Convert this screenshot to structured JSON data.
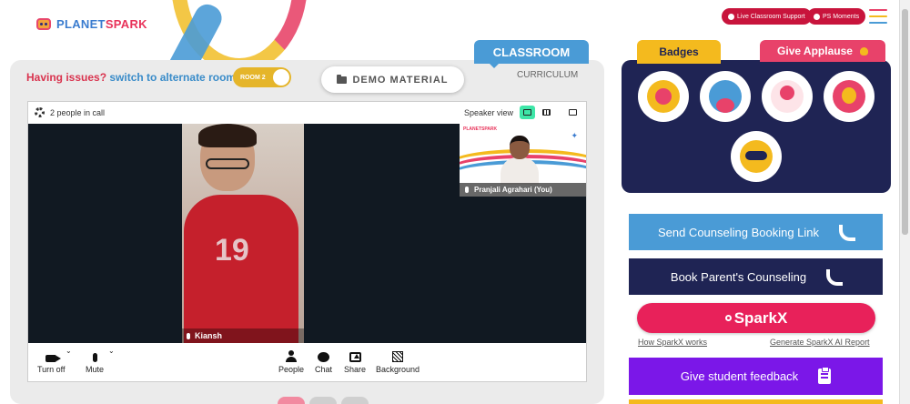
{
  "brand": {
    "part1": "PLANET",
    "part2": "SPARK"
  },
  "header": {
    "live_support": "Live Classroom Support",
    "ps_moments": "PS Moments"
  },
  "tabs": {
    "classroom": "CLASSROOM",
    "curriculum": "CURRICULUM",
    "badges": "Badges",
    "give_applause": "Give Applause"
  },
  "issues": {
    "question": "Having issues?",
    "switch": "switch to alternate room",
    "room_toggle": "ROOM 2"
  },
  "demo_material": "DEMO MATERIAL",
  "call": {
    "people_count": "2 people in call",
    "speaker_view": "Speaker view",
    "main_participant": "Kiansh",
    "self_brand": "PLANETSPARK",
    "self_participant": "Pranjali Agrahari (You)"
  },
  "controls": {
    "video": "Turn off",
    "mute": "Mute",
    "people": "People",
    "chat": "Chat",
    "share": "Share",
    "background": "Background"
  },
  "actions": {
    "send_counseling": "Send Counseling Booking Link",
    "book_counseling": "Book Parent's Counseling",
    "sparkx": "SparkX",
    "how_sparkx": "How SparkX works",
    "generate_report": "Generate SparkX AI Report",
    "give_feedback": "Give student feedback"
  },
  "colors": {
    "primary_blue": "#4a9bd6",
    "navy": "#1f2454",
    "pink": "#e8215a",
    "yellow": "#f4ba1e",
    "purple": "#7b17e8",
    "red_pill": "#c8143c"
  }
}
